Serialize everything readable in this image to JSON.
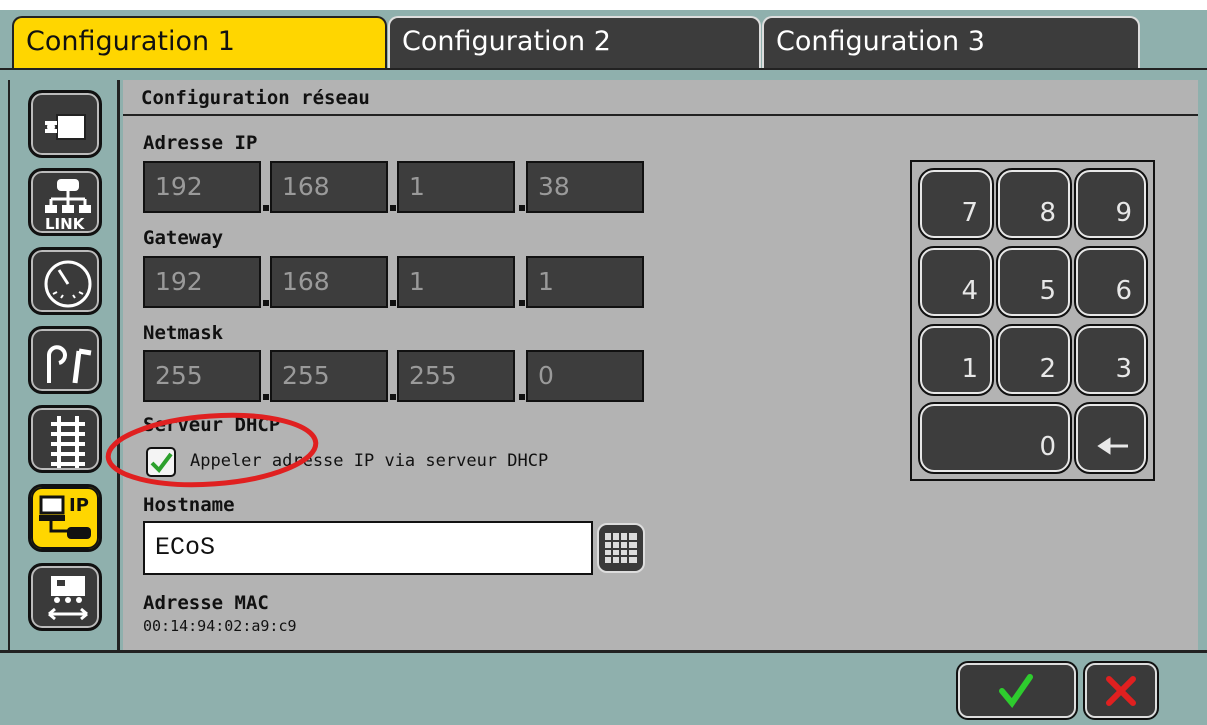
{
  "tabs": [
    {
      "label": "Configuration 1",
      "active": true
    },
    {
      "label": "Configuration 2",
      "active": false
    },
    {
      "label": "Configuration 3",
      "active": false
    }
  ],
  "sidebar": {
    "items": [
      {
        "icon": "device-icon"
      },
      {
        "icon": "link-network-icon",
        "label": "LINK"
      },
      {
        "icon": "clock-gauge-icon"
      },
      {
        "icon": "signal-turnout-icon"
      },
      {
        "icon": "track-icon"
      },
      {
        "icon": "ip-network-icon",
        "label": "IP",
        "active": true
      },
      {
        "icon": "locomotive-transfer-icon"
      }
    ]
  },
  "panel": {
    "title": "Configuration réseau",
    "ip": {
      "label": "Adresse IP",
      "octets": [
        "192",
        "168",
        "1",
        "38"
      ]
    },
    "gateway": {
      "label": "Gateway",
      "octets": [
        "192",
        "168",
        "1",
        "1"
      ]
    },
    "netmask": {
      "label": "Netmask",
      "octets": [
        "255",
        "255",
        "255",
        "0"
      ]
    },
    "dhcp": {
      "label": "Serveur DHCP",
      "checkbox_label": "Appeler adresse IP via serveur DHCP",
      "checked": true
    },
    "hostname": {
      "label": "Hostname",
      "value": "ECoS"
    },
    "mac": {
      "label": "Adresse MAC",
      "value": "00:14:94:02:a9:c9"
    }
  },
  "keypad": {
    "keys": [
      "7",
      "8",
      "9",
      "4",
      "5",
      "6",
      "1",
      "2",
      "3",
      "0"
    ],
    "backspace_icon": "backspace-arrow-icon"
  },
  "colors": {
    "accent": "#ffd600",
    "frame": "#8fb0ad",
    "panel": "#b3b3b3",
    "field": "#3d3d3d",
    "ok": "#2ecc2e",
    "cancel": "#e02020",
    "annotation": "#e02020"
  }
}
